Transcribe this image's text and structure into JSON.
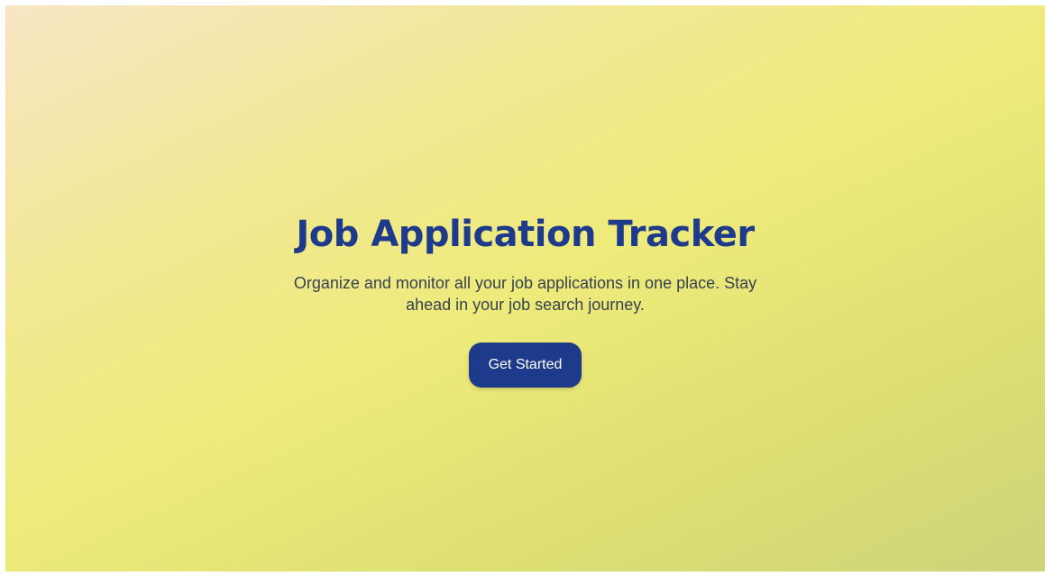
{
  "colors": {
    "title": "#1e3a8a",
    "subtitle": "#374151",
    "button_bg": "#1e3a8a",
    "button_text": "#ffffff",
    "bg_gradient_start": "#f8e5c4",
    "bg_gradient_mid": "#eeeb7b",
    "bg_gradient_end": "#cdd479"
  },
  "hero": {
    "title": "Job Application Tracker",
    "subtitle": "Organize and monitor all your job applications in one place. Stay ahead in your job search journey.",
    "cta_label": "Get Started"
  }
}
